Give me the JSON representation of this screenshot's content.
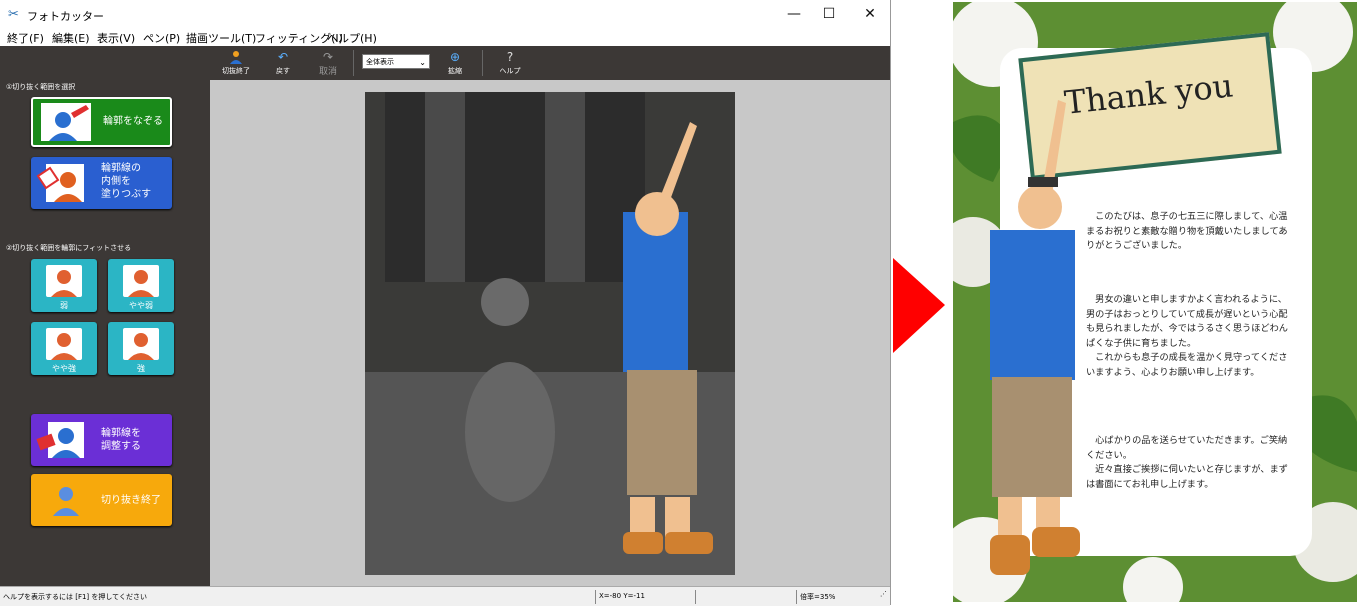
{
  "window": {
    "title": "フォトカッター",
    "icon": "scissors-icon",
    "controls": [
      "—",
      "☐",
      "✕"
    ]
  },
  "menubar": {
    "items": [
      "終了(F)",
      "編集(E)",
      "表示(V)",
      "ペン(P)",
      "描画ツール(T)",
      "フィッティング(I)",
      "ヘルプ(H)"
    ]
  },
  "sidebar": {
    "section1_label": "①切り抜く範囲を選択",
    "trace_button": "輪郭をなぞる",
    "fill_button": "輪郭線の\n内側を\n塗りつぶす",
    "section2_label": "②切り抜く範囲を輪郭にフィットさせる",
    "fit_buttons": [
      "弱",
      "やや弱",
      "やや強",
      "強"
    ],
    "adjust_button": "輪郭線を\n調整する",
    "finish_button": "切り抜き終了",
    "colors": {
      "trace": "#1a8a1a",
      "fill": "#2a5fd0",
      "fit": "#2bb5c5",
      "adjust": "#6b2fd6",
      "finish": "#f7a90c"
    }
  },
  "toolbar": {
    "finish_label": "切抜終了",
    "undo_label": "戻す",
    "cancel_label": "取消",
    "zoom_value": "全体表示",
    "enlarge_label": "拡縮",
    "help_label": "ヘルプ"
  },
  "statusbar": {
    "help_hint": "ヘルプを表示するには [F1] を押してください",
    "coords": "X=-80 Y=-11",
    "zoom": "倍率=35%"
  },
  "card": {
    "title": "Thank you",
    "paragraph1": "　このたびは、息子の七五三に際しまして、心温まるお祝りと素敵な贈り物を頂戴いたしましてありがとうございました。",
    "paragraph2": "　男女の違いと申しますかよく言われるように、男の子はおっとりしていて成長が遅いという心配も見られましたが、今ではうるさく思うほどわんぱくな子供に育ちました。\n　これからも息子の成長を温かく見守ってくださいますよう、心よりお願い申し上げます。",
    "paragraph3": "　心ばかりの品を送らせていただきます。ご笑納ください。\n　近々直接ご挨拶に伺いたいと存じますが、まずは書面にてお礼申し上げます。"
  }
}
